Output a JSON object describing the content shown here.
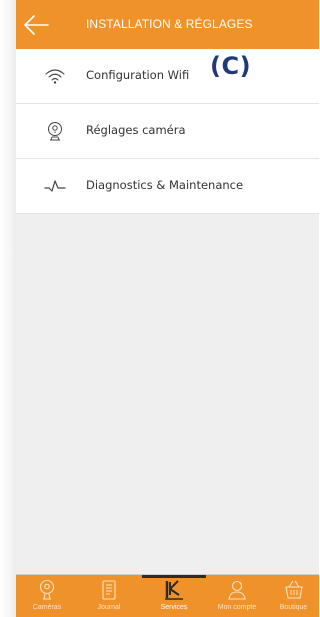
{
  "header": {
    "title": "INSTALLATION & RÉGLAGES",
    "back_icon": "arrow-left-icon"
  },
  "menu": {
    "items": [
      {
        "label": "Configuration Wifi",
        "icon": "wifi-icon"
      },
      {
        "label": "Réglages caméra",
        "icon": "camera-icon"
      },
      {
        "label": "Diagnostics & Maintenance",
        "icon": "pulse-icon"
      }
    ]
  },
  "annotation": {
    "text": "(C)"
  },
  "tabbar": {
    "tabs": [
      {
        "label": "Caméras",
        "icon": "camera-icon",
        "active": false
      },
      {
        "label": "Journal",
        "icon": "journal-icon",
        "active": false
      },
      {
        "label": "Services",
        "icon": "k-logo-icon",
        "active": true
      },
      {
        "label": "Mon compte",
        "icon": "user-icon",
        "active": false
      },
      {
        "label": "Boutique",
        "icon": "basket-icon",
        "active": false
      }
    ]
  },
  "colors": {
    "accent": "#f0922a",
    "annotation": "#1e3a78",
    "background": "#efefef",
    "active_indicator": "#2b2b2b"
  }
}
